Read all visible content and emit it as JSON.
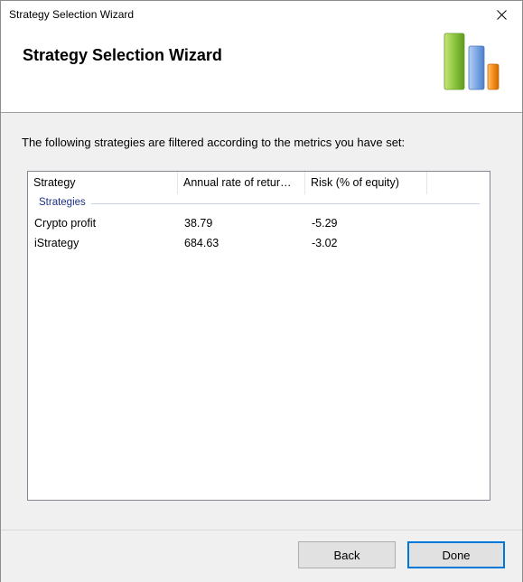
{
  "window": {
    "title": "Strategy Selection Wizard",
    "close_icon": "close-icon"
  },
  "header": {
    "heading": "Strategy Selection Wizard",
    "logo_icon": "bar-chart-logo",
    "logo_colors": [
      "#8cc63f",
      "#6f9fe0",
      "#f58d1a"
    ]
  },
  "content": {
    "intro": "The following strategies are filtered according to the metrics you have set:",
    "table": {
      "columns": [
        "Strategy",
        "Annual rate of retur…",
        "Risk (% of equity)"
      ],
      "group_label": "Strategies",
      "rows": [
        {
          "strategy": "Crypto profit",
          "annual_return": "38.79",
          "risk": "-5.29"
        },
        {
          "strategy": "iStrategy",
          "annual_return": "684.63",
          "risk": "-3.02"
        }
      ]
    }
  },
  "footer": {
    "back_label": "Back",
    "done_label": "Done"
  }
}
